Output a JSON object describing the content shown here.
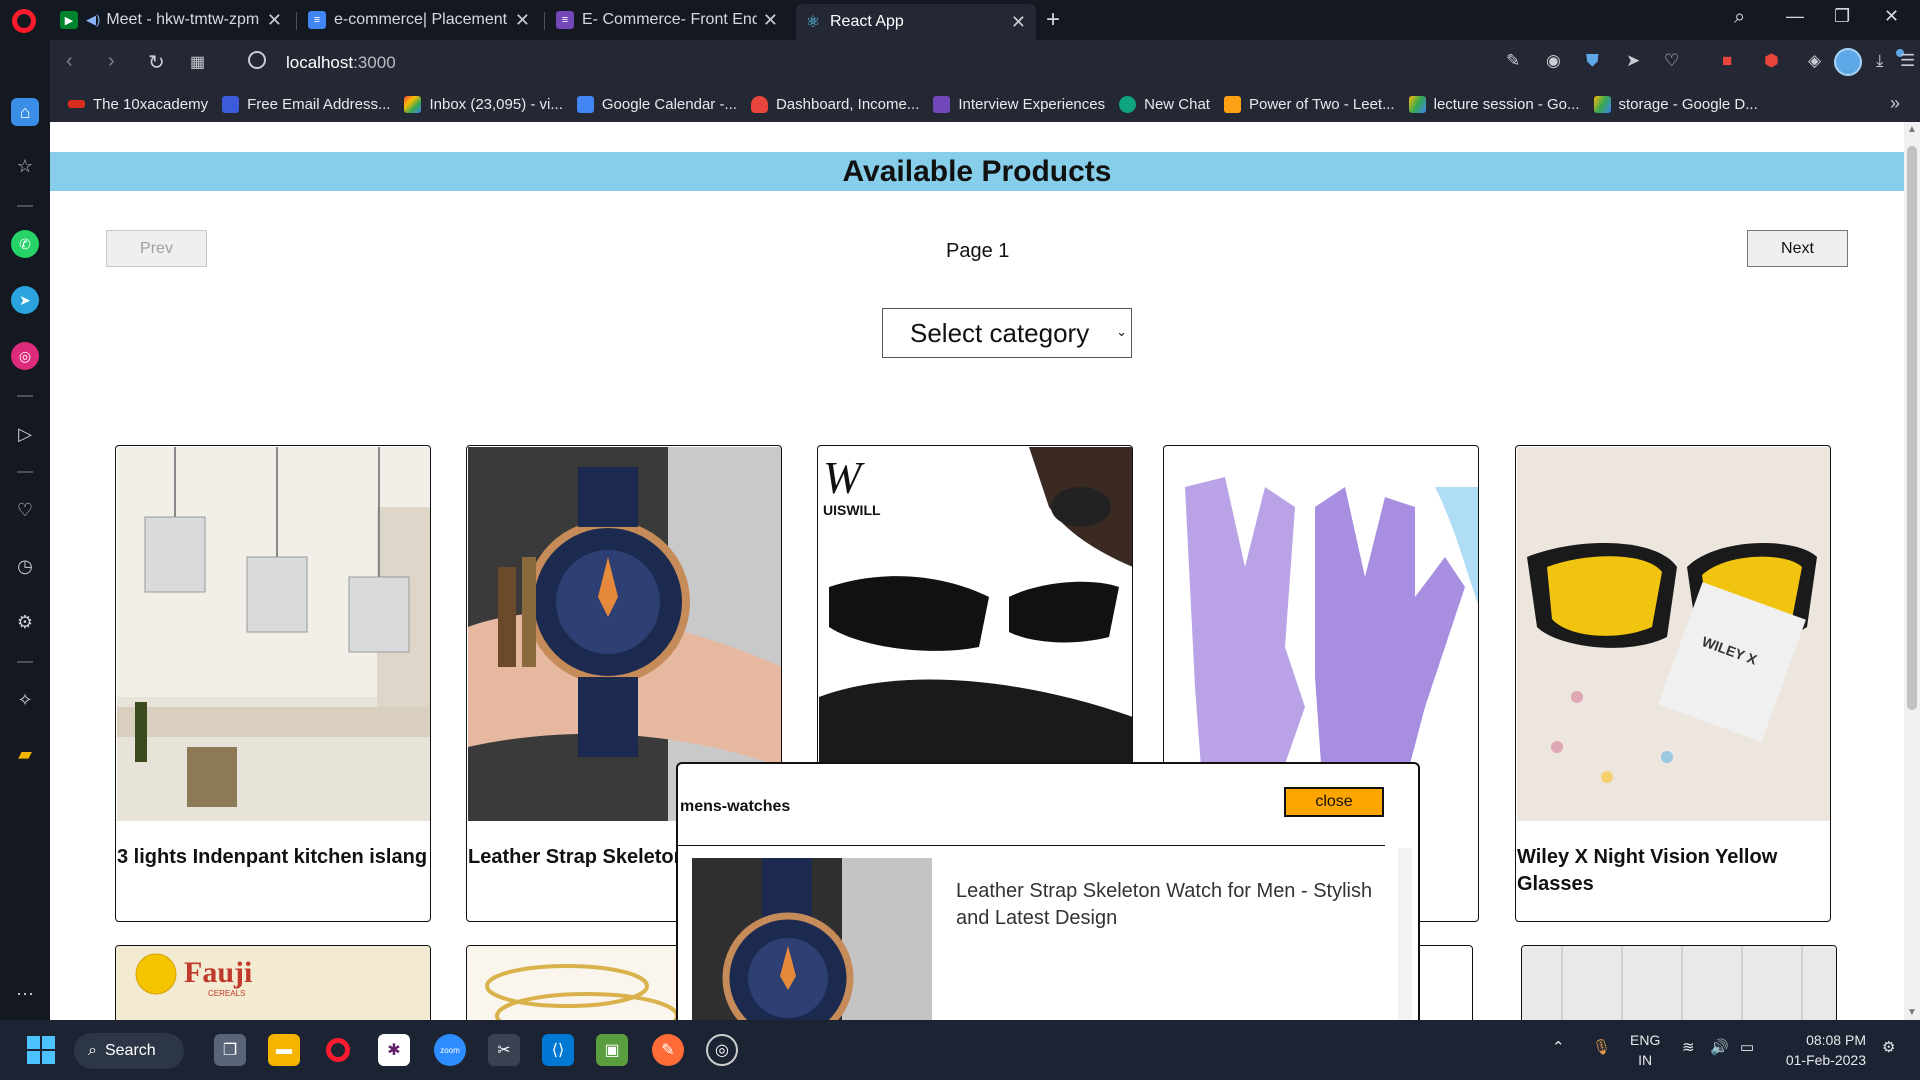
{
  "browser": {
    "tabs": [
      {
        "label": "Meet - hkw-tmtw-zpm",
        "active": false
      },
      {
        "label": "e-commerce| Placement Re",
        "active": false
      },
      {
        "label": "E- Commerce- Front End",
        "active": false
      },
      {
        "label": "React App",
        "active": true
      }
    ],
    "url_host": "localhost",
    "url_port": ":3000",
    "bookmarks": [
      "The 10xacademy",
      "Free Email Address...",
      "Inbox (23,095) - vi...",
      "Google Calendar -...",
      "Dashboard, Income...",
      "Interview Experiences",
      "New Chat",
      "Power of Two - Leet...",
      "lecture session - Go...",
      "storage - Google D..."
    ]
  },
  "page": {
    "heading": "Available Products",
    "prev_label": "Prev",
    "next_label": "Next",
    "page_label": "Page 1",
    "category_select": "Select category",
    "products": [
      {
        "name": "3 lights Indenpant kitchen islang"
      },
      {
        "name": "Leather Strap Skeleton Watch for Men - Stylish and Latest Design"
      },
      {
        "name": ""
      },
      {
        "name": ""
      },
      {
        "name": "Wiley X Night Vision Yellow Glasses"
      }
    ],
    "second_row_logo": "Fauji",
    "second_row_sub": "CEREALS"
  },
  "modal": {
    "category": "mens-watches",
    "close_label": "close",
    "description": "Leather Strap Skeleton Watch for Men - Stylish and Latest Design"
  },
  "brand_image_text": {
    "sunglass_brand": "UISWILL",
    "glasses_tag": "WILEY X"
  },
  "taskbar": {
    "search_label": "Search",
    "lang_top": "ENG",
    "lang_bottom": "IN",
    "time": "08:08 PM",
    "date": "01-Feb-2023"
  },
  "colors": {
    "banner": "#87ceeb",
    "close_button": "#ffa500",
    "browser_dark": "#141821",
    "toolbar": "#232834"
  }
}
